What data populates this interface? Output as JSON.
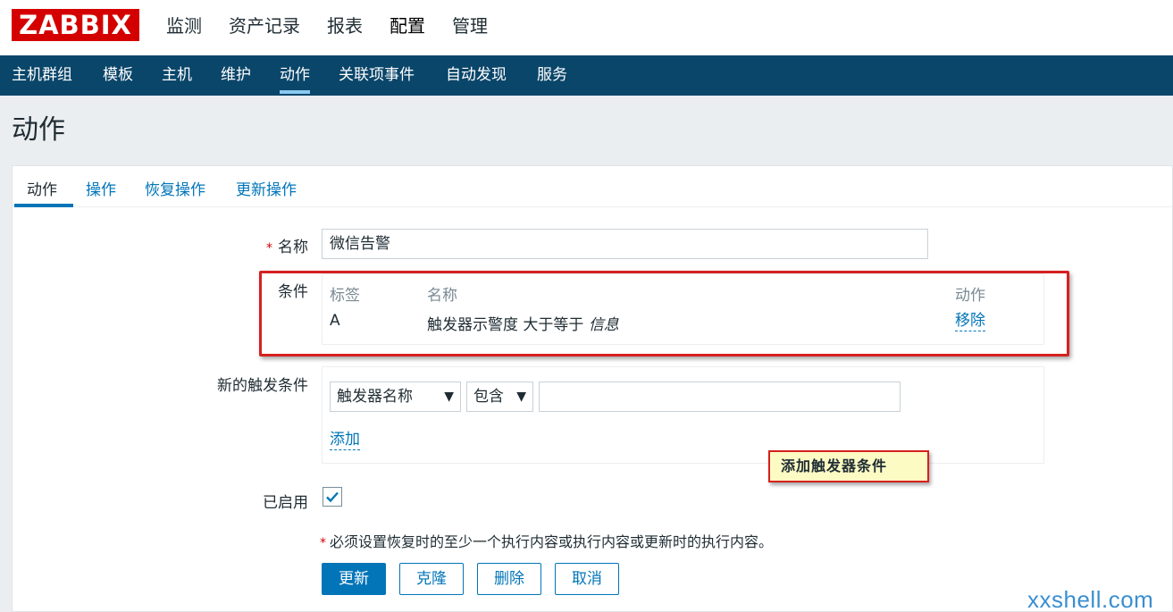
{
  "app": {
    "logo": "ZABBIX"
  },
  "top_menu": [
    "监测",
    "资产记录",
    "报表",
    "配置",
    "管理"
  ],
  "sub_nav": [
    "主机群组",
    "模板",
    "主机",
    "维护",
    "动作",
    "关联项事件",
    "自动发现",
    "服务"
  ],
  "page_title": "动作",
  "tabs": [
    "动作",
    "操作",
    "恢复操作",
    "更新操作"
  ],
  "form": {
    "name_label": "名称",
    "name_value": "微信告警",
    "conditions_label": "条件",
    "conditions_headers": {
      "tag": "标签",
      "name": "名称",
      "action": "动作"
    },
    "conditions_rows": [
      {
        "tag": "A",
        "name_prefix": "触发器示警度 大于等于",
        "name_value": "信息",
        "action": "移除"
      }
    ],
    "new_condition_label": "新的触发条件",
    "new_condition_type": "触发器名称",
    "new_condition_operator": "包含",
    "new_condition_value": "",
    "add_link": "添加",
    "enabled_label": "已启用",
    "enabled": true,
    "required_note": "必须设置恢复时的至少一个执行内容或执行内容或更新时的执行内容。",
    "required_marker": "*"
  },
  "buttons": {
    "update": "更新",
    "clone": "克隆",
    "delete": "删除",
    "cancel": "取消"
  },
  "annotation": "添加触发器条件",
  "watermark": "xxshell.com",
  "colors": {
    "brand": "#d40000",
    "nav": "#0a466a",
    "accent": "#0275b8",
    "highlight": "#d62020",
    "callout_bg": "#fdfbc4"
  }
}
